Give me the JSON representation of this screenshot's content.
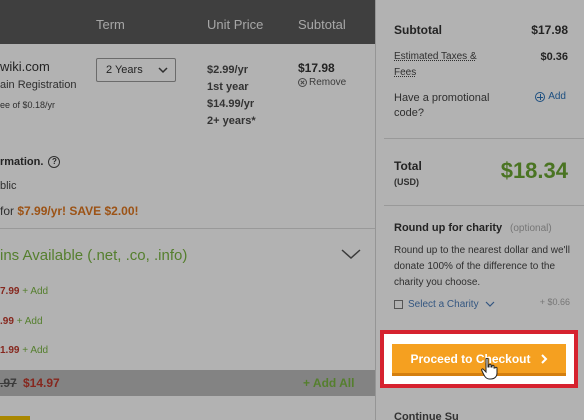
{
  "cart": {
    "headers": {
      "term": "Term",
      "unit_price": "Unit Price",
      "subtotal": "Subtotal"
    },
    "item": {
      "domain": "wiki.com",
      "type": "ain Registration",
      "fee": "ee of $0.18/yr",
      "term_selected": "2 Years",
      "unit_price_lines": [
        "$2.99/yr",
        "1st year",
        "$14.99/yr",
        "2+ years*"
      ],
      "subtotal": "$17.98",
      "remove_label": "Remove"
    },
    "privacy": {
      "label": "rmation.",
      "help_icon": "?",
      "status": "blic",
      "offer_prefix": "for ",
      "offer_promo": "$7.99/yr! SAVE $2.00!"
    },
    "more_domains": {
      "title": "ins Available (.net, .co, .info)",
      "rows": [
        {
          "price": "7.99",
          "add": "+ Add"
        },
        {
          "price": ".99",
          "add": "+ Add"
        },
        {
          "price": "1.99",
          "add": "+ Add"
        }
      ]
    },
    "footer": {
      "old_price": ".97",
      "new_price": "$14.97",
      "add_all": "+ Add All"
    }
  },
  "summary": {
    "subtotal_label": "Subtotal",
    "subtotal_value": "$17.98",
    "tax_label": "Estimated Taxes & Fees",
    "tax_value": "$0.36",
    "promo_label": "Have a promotional code?",
    "promo_add": "Add",
    "total_label": "Total",
    "total_currency": "(USD)",
    "total_value": "$18.34",
    "charity_title": "Round up for charity",
    "charity_optional": "(optional)",
    "charity_desc": "Round up to the nearest dollar and we'll donate 100% of the difference to the charity you choose.",
    "charity_select": "Select a Charity",
    "charity_amount": "+ $0.66",
    "checkout_label": "Proceed to Checkout",
    "next_section": "Continue Su"
  },
  "colors": {
    "header_bg": "#5b5b5b",
    "total_green": "#6aa632",
    "checkout_orange": "#f5a020",
    "highlight_red": "#d6222f",
    "promo_orange": "#e07820"
  }
}
